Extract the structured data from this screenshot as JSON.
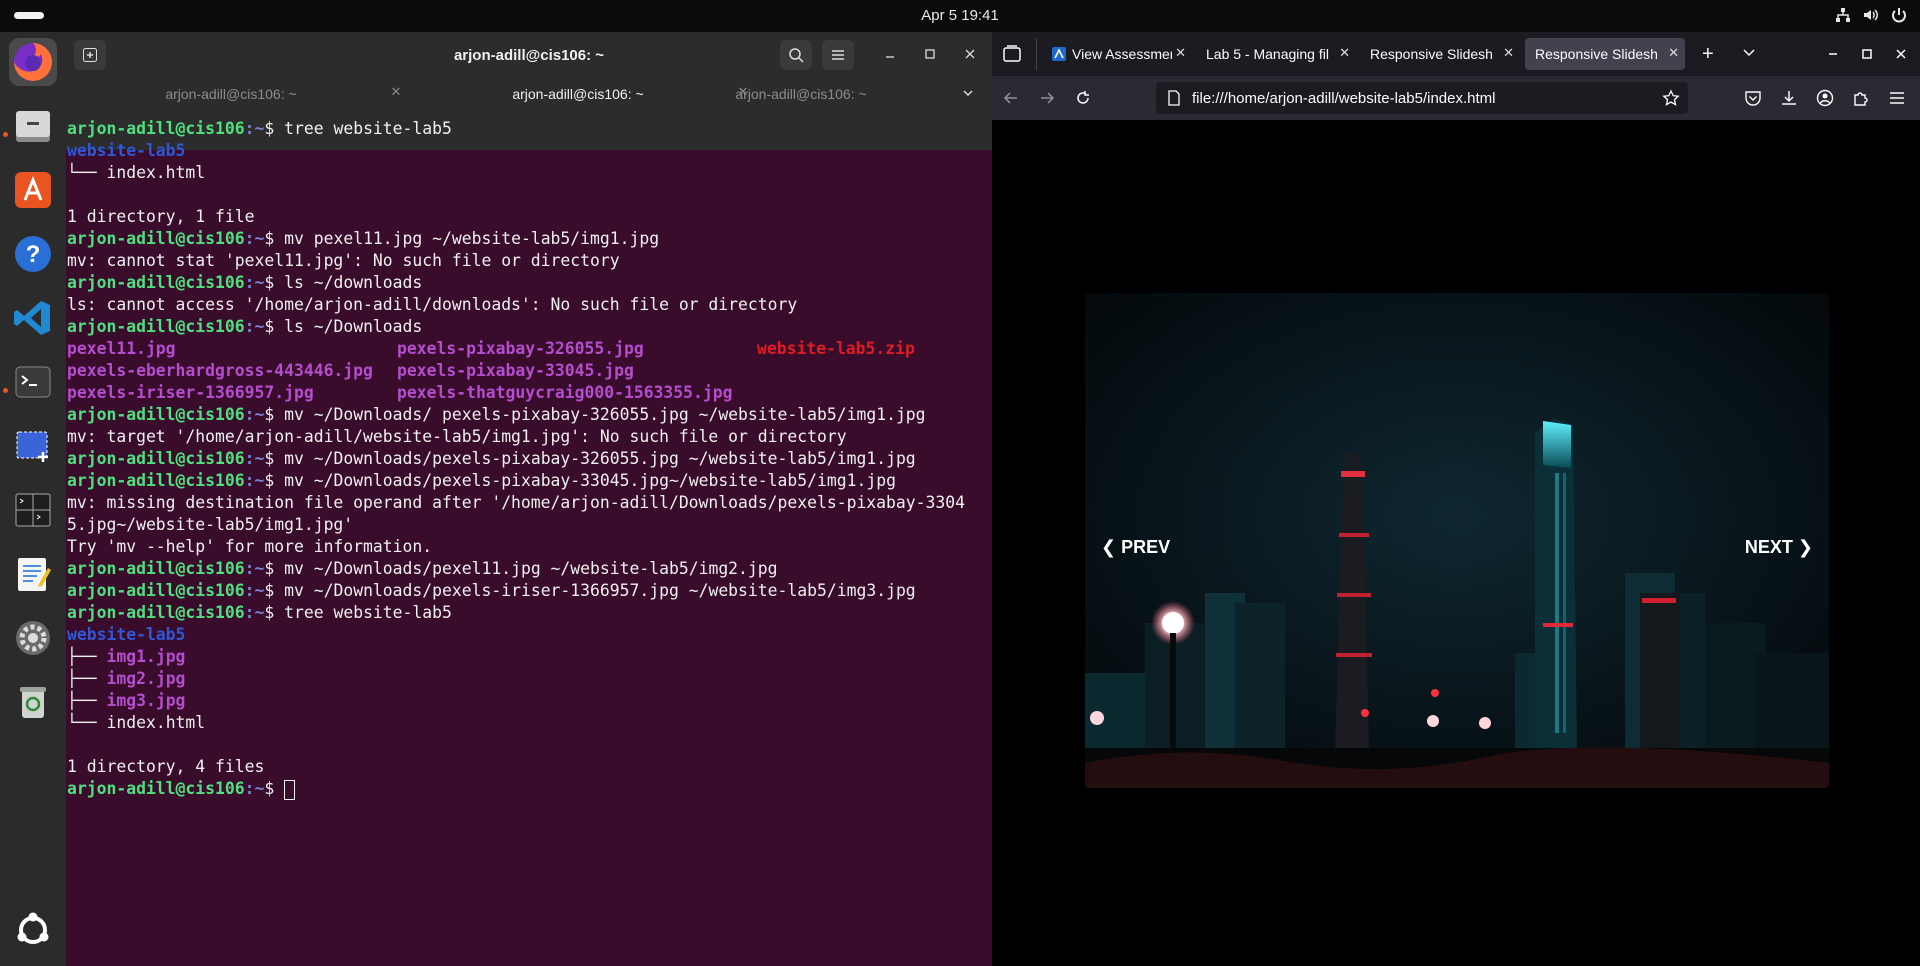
{
  "topbar": {
    "clock": "Apr 5  19:41"
  },
  "dock": {
    "items": [
      "firefox-icon",
      "files-icon",
      "app-center-icon",
      "help-icon",
      "vscode-icon",
      "terminal-icon",
      "screenshot-icon",
      "terminal-split-icon",
      "text-editor-icon",
      "settings-icon",
      "trash-icon",
      "show-apps-icon"
    ]
  },
  "terminal": {
    "title": "arjon-adill@cis106: ~",
    "tabs": [
      {
        "label": "arjon-adill@cis106: ~",
        "active": false
      },
      {
        "label": "arjon-adill@cis106: ~",
        "active": true
      },
      {
        "label": "arjon-adill@cis106: ~",
        "active": false
      }
    ],
    "prompt_user": "arjon-adill@cis106",
    "prompt_path": ":~",
    "prompt_dollar": "$ ",
    "lines": [
      {
        "t": "p",
        "cmd": "tree website-lab5"
      },
      {
        "t": "dir",
        "text": "website-lab5"
      },
      {
        "t": "o",
        "text": "└── index.html"
      },
      {
        "t": "o",
        "text": ""
      },
      {
        "t": "o",
        "text": "1 directory, 1 file"
      },
      {
        "t": "p",
        "cmd": "mv pexel11.jpg ~/website-lab5/img1.jpg"
      },
      {
        "t": "o",
        "text": "mv: cannot stat 'pexel11.jpg': No such file or directory"
      },
      {
        "t": "p",
        "cmd": "ls ~/downloads"
      },
      {
        "t": "o",
        "text": "ls: cannot access '/home/arjon-adill/downloads': No such file or directory"
      },
      {
        "t": "p",
        "cmd": "ls ~/Downloads"
      },
      {
        "t": "ls",
        "cols": [
          [
            "img",
            "pexel11.jpg"
          ],
          [
            "img",
            "pexels-pixabay-326055.jpg"
          ],
          [
            "zip",
            "website-lab5.zip"
          ]
        ]
      },
      {
        "t": "ls",
        "cols": [
          [
            "img",
            "pexels-eberhardgross-443446.jpg"
          ],
          [
            "img",
            "pexels-pixabay-33045.jpg"
          ]
        ]
      },
      {
        "t": "ls",
        "cols": [
          [
            "img",
            "pexels-iriser-1366957.jpg"
          ],
          [
            "img",
            "pexels-thatguycraig000-1563355.jpg"
          ]
        ]
      },
      {
        "t": "p",
        "cmd": "mv ~/Downloads/ pexels-pixabay-326055.jpg ~/website-lab5/img1.jpg"
      },
      {
        "t": "o",
        "text": "mv: target '/home/arjon-adill/website-lab5/img1.jpg': No such file or directory"
      },
      {
        "t": "p",
        "cmd": "mv ~/Downloads/pexels-pixabay-326055.jpg ~/website-lab5/img1.jpg"
      },
      {
        "t": "p",
        "cmd": "mv ~/Downloads/pexels-pixabay-33045.jpg~/website-lab5/img1.jpg"
      },
      {
        "t": "o",
        "text": "mv: missing destination file operand after '/home/arjon-adill/Downloads/pexels-pixabay-3304"
      },
      {
        "t": "o",
        "text": "5.jpg~/website-lab5/img1.jpg'"
      },
      {
        "t": "o",
        "text": "Try 'mv --help' for more information."
      },
      {
        "t": "p",
        "cmd": "mv ~/Downloads/pexel11.jpg ~/website-lab5/img2.jpg"
      },
      {
        "t": "p",
        "cmd": "mv ~/Downloads/pexels-iriser-1366957.jpg ~/website-lab5/img3.jpg"
      },
      {
        "t": "p",
        "cmd": "tree website-lab5"
      },
      {
        "t": "dir",
        "text": "website-lab5"
      },
      {
        "t": "tree",
        "prefix": "├── ",
        "cls": "img",
        "text": "img1.jpg"
      },
      {
        "t": "tree",
        "prefix": "├── ",
        "cls": "img",
        "text": "img2.jpg"
      },
      {
        "t": "tree",
        "prefix": "├── ",
        "cls": "img",
        "text": "img3.jpg"
      },
      {
        "t": "tree",
        "prefix": "└── ",
        "cls": "",
        "text": "index.html"
      },
      {
        "t": "o",
        "text": ""
      },
      {
        "t": "o",
        "text": "1 directory, 4 files"
      },
      {
        "t": "p",
        "cmd": "",
        "cursor": true
      }
    ]
  },
  "browser": {
    "tabs": [
      {
        "label": "View Assessmen",
        "selected": false
      },
      {
        "label": "Lab 5 - Managing fil",
        "selected": false
      },
      {
        "label": "Responsive Slidesh",
        "selected": false
      },
      {
        "label": "Responsive Slidesh",
        "selected": true
      }
    ],
    "url": "file:///home/arjon-adill/website-lab5/index.html",
    "slideshow": {
      "prev_label": "❮ PREV",
      "next_label": "NEXT ❯"
    }
  },
  "colors": {
    "terminal_bg": "#380c2a",
    "prompt_green": "#4ee07e",
    "accent_orange": "#e95420"
  }
}
